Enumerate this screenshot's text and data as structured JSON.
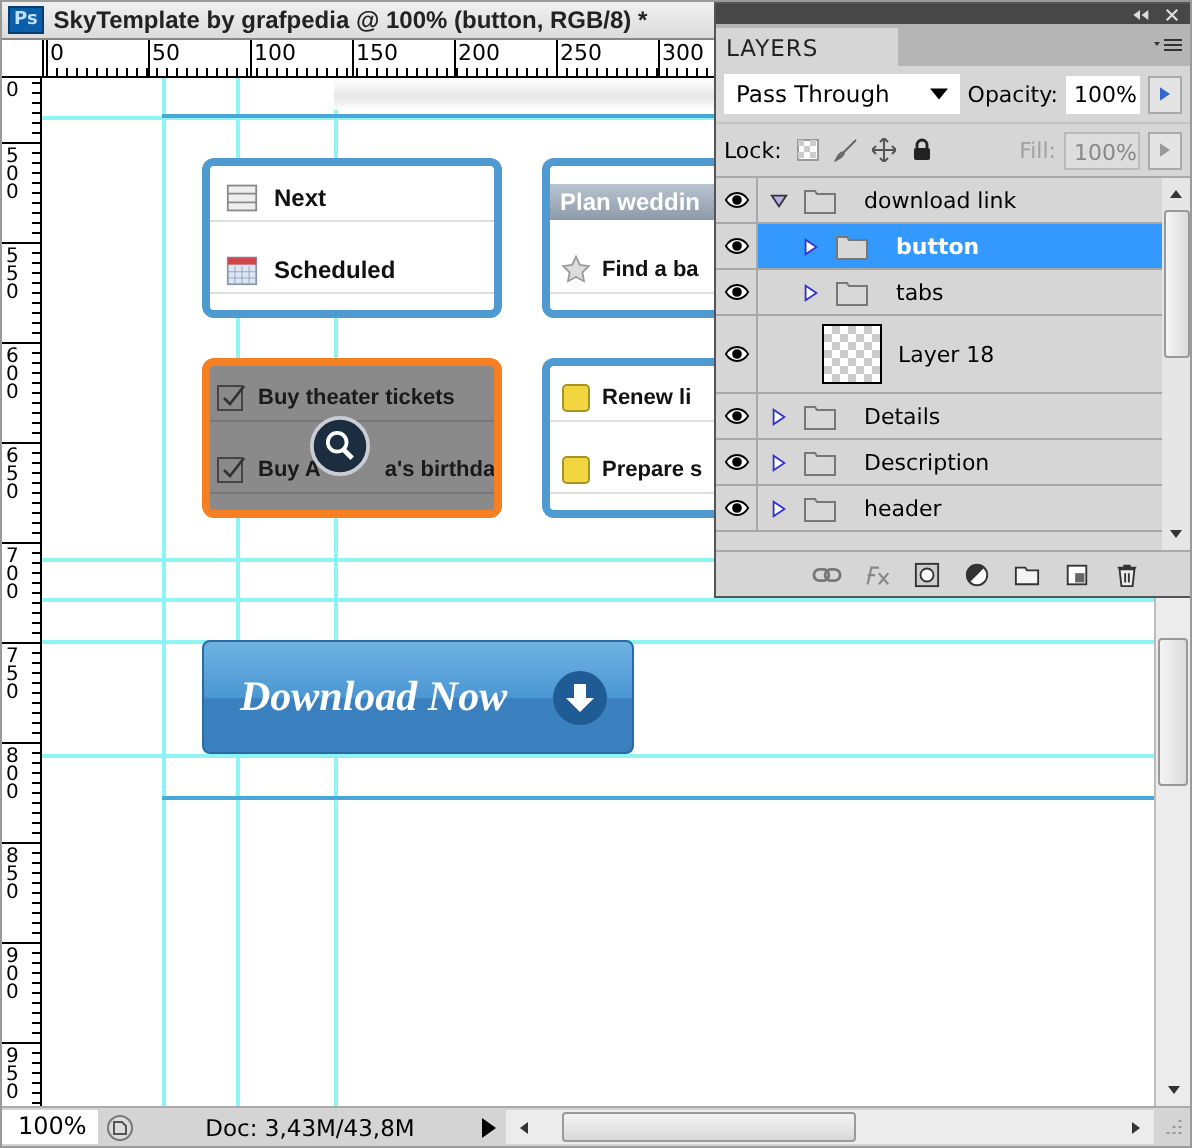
{
  "window": {
    "app_icon": "Ps",
    "title": "SkyTemplate by grafpedia @ 100% (button, RGB/8) *"
  },
  "rulers": {
    "horizontal": [
      "0",
      "50",
      "100",
      "150",
      "200",
      "250",
      "300"
    ],
    "vertical": [
      "0",
      "500",
      "550",
      "600",
      "650",
      "700",
      "750",
      "800",
      "850",
      "900",
      "950"
    ]
  },
  "canvas": {
    "cards": [
      {
        "highlighted": false,
        "rows": [
          {
            "kind": "list",
            "text": "Next"
          },
          {
            "kind": "calendar",
            "text": "Scheduled"
          }
        ]
      },
      {
        "highlighted": false,
        "rows": [
          {
            "kind": "section",
            "text": "Plan weddin"
          },
          {
            "kind": "star",
            "text": "Find a ba"
          }
        ]
      },
      {
        "highlighted": true,
        "rows": [
          {
            "kind": "checkbox",
            "text": "Buy theater tickets"
          },
          {
            "kind": "checkbox",
            "text": "Buy A",
            "text_after": "a's birthda"
          }
        ]
      },
      {
        "highlighted": false,
        "rows": [
          {
            "kind": "note",
            "text": "Renew li"
          },
          {
            "kind": "note",
            "text": "Prepare s"
          }
        ]
      }
    ],
    "download_button": {
      "label": "Download Now"
    }
  },
  "layers_panel": {
    "tab": "LAYERS",
    "blend_mode": "Pass Through",
    "opacity_label": "Opacity:",
    "opacity": "100%",
    "lock_label": "Lock:",
    "fill_label": "Fill:",
    "fill": "100%",
    "fill_disabled": true,
    "layers": [
      {
        "kind": "group",
        "name": "download link",
        "visible": true,
        "expanded": true,
        "selected": false,
        "children": [
          {
            "kind": "group",
            "name": "button",
            "visible": true,
            "expanded": false,
            "selected": true
          },
          {
            "kind": "group",
            "name": "tabs",
            "visible": true,
            "expanded": false,
            "selected": false
          },
          {
            "kind": "layer",
            "name": "Layer 18",
            "visible": true,
            "selected": false
          }
        ]
      },
      {
        "kind": "group",
        "name": "Details",
        "visible": true,
        "expanded": false,
        "selected": false
      },
      {
        "kind": "group",
        "name": "Description",
        "visible": true,
        "expanded": false,
        "selected": false
      },
      {
        "kind": "group",
        "name": "header",
        "visible": true,
        "expanded": false,
        "selected": false
      }
    ]
  },
  "status_bar": {
    "zoom": "100%",
    "doc": "Doc: 3,43M/43,8M"
  }
}
